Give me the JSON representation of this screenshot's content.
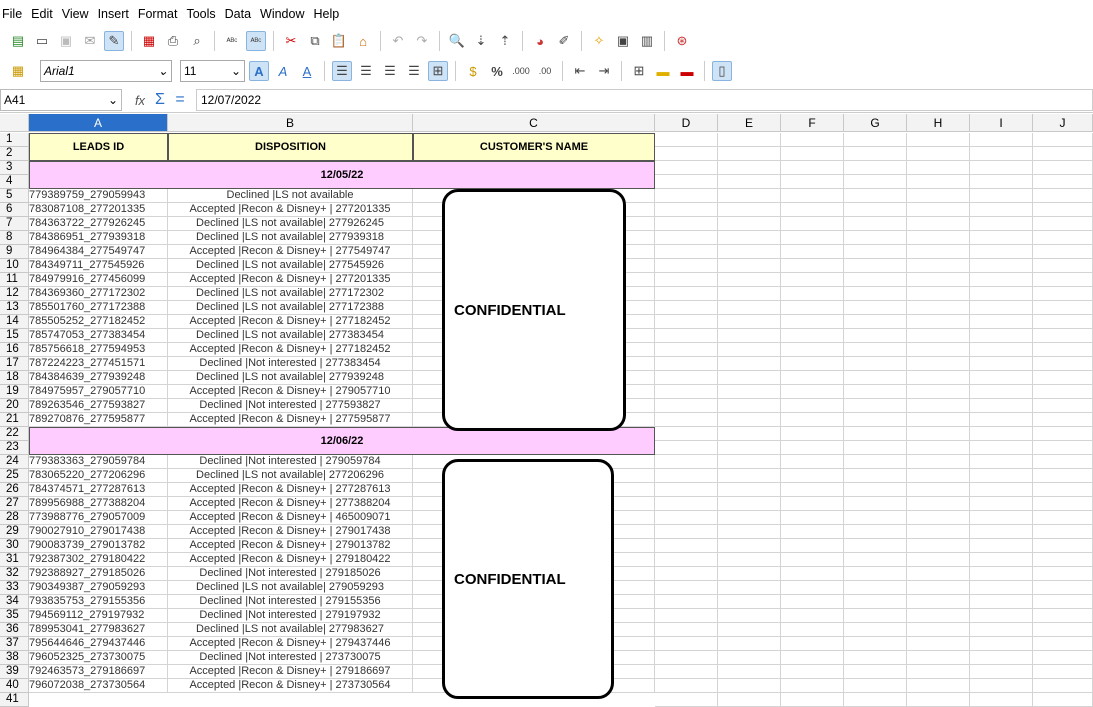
{
  "menu": [
    "File",
    "Edit",
    "View",
    "Insert",
    "Format",
    "Tools",
    "Data",
    "Window",
    "Help"
  ],
  "font_name": "Arial1",
  "font_size": "11",
  "name_box": "A41",
  "formula_value": "12/07/2022",
  "columns": [
    "A",
    "B",
    "C",
    "D",
    "E",
    "F",
    "G",
    "H",
    "I",
    "J"
  ],
  "headers": {
    "leads_id": "LEADS ID",
    "disposition": "DISPOSITION",
    "customer_name": "CUSTOMER'S NAME"
  },
  "sections": [
    {
      "date": "12/05/22",
      "confidential": "CONFIDENTIAL",
      "rows": [
        [
          "779389759_279059943",
          "Declined |LS not available"
        ],
        [
          "783087108_277201335",
          "Accepted |Recon & Disney+ | 277201335"
        ],
        [
          "784363722_277926245",
          "Declined |LS not available| 277926245"
        ],
        [
          "784386951_277939318",
          "Declined |LS not available| 277939318"
        ],
        [
          "784964384_277549747",
          "Accepted |Recon & Disney+ | 277549747"
        ],
        [
          "784349711_277545926",
          "Declined |LS not available| 277545926"
        ],
        [
          "784979916_277456099",
          "Accepted |Recon & Disney+ | 277201335"
        ],
        [
          "784369360_277172302",
          "Declined |LS not available| 277172302"
        ],
        [
          "785501760_277172388",
          "Declined |LS not available| 277172388"
        ],
        [
          "785505252_277182452",
          "Accepted |Recon & Disney+ | 277182452"
        ],
        [
          "785747053_277383454",
          "Declined |LS not available| 277383454"
        ],
        [
          "785756618_277594953",
          "Accepted |Recon & Disney+ | 277182452"
        ],
        [
          "787224223_277451571",
          "Declined |Not interested | 277383454"
        ],
        [
          "784384639_277939248",
          "Declined |LS not available| 277939248"
        ],
        [
          "784975957_279057710",
          "Accepted |Recon & Disney+ | 279057710"
        ],
        [
          "789263546_277593827",
          "Declined |Not interested | 277593827"
        ],
        [
          "789270876_277595877",
          "Accepted |Recon & Disney+ | 277595877"
        ]
      ]
    },
    {
      "date": "12/06/22",
      "confidential": "CONFIDENTIAL",
      "rows": [
        [
          "779383363_279059784",
          "Declined |Not interested | 279059784"
        ],
        [
          "783065220_277206296",
          "Declined |LS not available| 277206296"
        ],
        [
          "784374571_277287613",
          "Accepted |Recon & Disney+ | 277287613"
        ],
        [
          "789956988_277388204",
          "Accepted |Recon & Disney+ | 277388204"
        ],
        [
          "773988776_279057009",
          "Accepted |Recon & Disney+ | 465009071"
        ],
        [
          "790027910_279017438",
          "Accepted |Recon & Disney+ | 279017438"
        ],
        [
          "790083739_279013782",
          "Accepted |Recon & Disney+ | 279013782"
        ],
        [
          "792387302_279180422",
          "Accepted |Recon & Disney+ | 279180422"
        ],
        [
          "792388927_279185026",
          "Declined |Not interested | 279185026"
        ],
        [
          "790349387_279059293",
          "Declined |LS not available| 279059293"
        ],
        [
          "793835753_279155356",
          "Declined |Not interested | 279155356"
        ],
        [
          "794569112_279197932",
          "Declined |Not interested | 279197932"
        ],
        [
          "789953041_277983627",
          "Declined |LS not available| 277983627"
        ],
        [
          "795644646_279437446",
          "Accepted |Recon & Disney+ | 279437446"
        ],
        [
          "796052325_273730075",
          "Declined |Not interested | 273730075"
        ],
        [
          "792463573_279186697",
          "Accepted |Recon & Disney+ | 279186697"
        ],
        [
          "796072038_273730564",
          "Accepted |Recon & Disney+ | 273730564"
        ]
      ]
    }
  ]
}
